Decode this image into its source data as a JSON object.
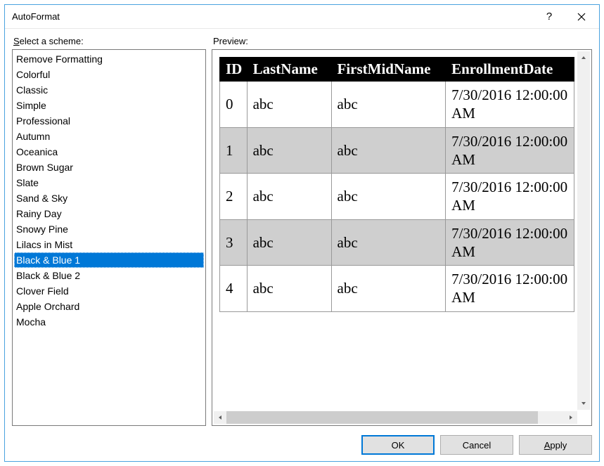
{
  "dialog": {
    "title": "AutoFormat"
  },
  "labels": {
    "select_scheme_pre": "S",
    "select_scheme_post": "elect a scheme:",
    "preview": "Preview:"
  },
  "schemes": {
    "items": [
      "Remove Formatting",
      "Colorful",
      "Classic",
      "Simple",
      "Professional",
      "Autumn",
      "Oceanica",
      "Brown Sugar",
      "Slate",
      "Sand & Sky",
      "Rainy Day",
      "Snowy Pine",
      "Lilacs in Mist",
      "Black & Blue 1",
      "Black & Blue 2",
      "Clover Field",
      "Apple Orchard",
      "Mocha"
    ],
    "selected_index": 13
  },
  "preview": {
    "headers": [
      "ID",
      "LastName",
      "FirstMidName",
      "EnrollmentDate"
    ],
    "rows": [
      {
        "id": "0",
        "last": "abc",
        "first": "abc",
        "date": "7/30/2016 12:00:00 AM"
      },
      {
        "id": "1",
        "last": "abc",
        "first": "abc",
        "date": "7/30/2016 12:00:00 AM"
      },
      {
        "id": "2",
        "last": "abc",
        "first": "abc",
        "date": "7/30/2016 12:00:00 AM"
      },
      {
        "id": "3",
        "last": "abc",
        "first": "abc",
        "date": "7/30/2016 12:00:00 AM"
      },
      {
        "id": "4",
        "last": "abc",
        "first": "abc",
        "date": "7/30/2016 12:00:00 AM"
      }
    ]
  },
  "buttons": {
    "ok": "OK",
    "cancel": "Cancel",
    "apply_pre": "A",
    "apply_post": "pply"
  }
}
